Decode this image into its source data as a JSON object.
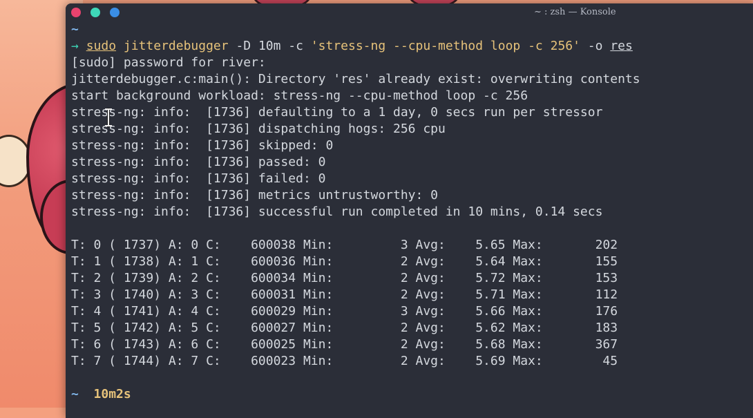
{
  "window": {
    "title": "~ : zsh — Konsole"
  },
  "terminal": {
    "cwd_line": "~",
    "command": {
      "arrow": "→",
      "sudo": "sudo",
      "binary": "jitterdebugger",
      "args1": " -D 10m -c ",
      "quoted": "'stress-ng --cpu-method loop -c 256'",
      "args2": " -o ",
      "outdir": "res"
    },
    "output": [
      "[sudo] password for river:",
      "jitterdebugger.c:main(): Directory 'res' already exist: overwriting contents",
      "start background workload: stress-ng --cpu-method loop -c 256",
      "stress-ng: info:  [1736] defaulting to a 1 day, 0 secs run per stressor",
      "stress-ng: info:  [1736] dispatching hogs: 256 cpu",
      "stress-ng: info:  [1736] skipped: 0",
      "stress-ng: info:  [1736] passed: 0",
      "stress-ng: info:  [1736] failed: 0",
      "stress-ng: info:  [1736] metrics untrustworthy: 0",
      "stress-ng: info:  [1736] successful run completed in 10 mins, 0.14 secs"
    ],
    "results": [
      "T: 0 ( 1737) A: 0 C:    600038 Min:         3 Avg:    5.65 Max:       202",
      "T: 1 ( 1738) A: 1 C:    600036 Min:         2 Avg:    5.64 Max:       155",
      "T: 2 ( 1739) A: 2 C:    600034 Min:         2 Avg:    5.72 Max:       153",
      "T: 3 ( 1740) A: 3 C:    600031 Min:         2 Avg:    5.71 Max:       112",
      "T: 4 ( 1741) A: 4 C:    600029 Min:         3 Avg:    5.66 Max:       176",
      "T: 5 ( 1742) A: 5 C:    600027 Min:         2 Avg:    5.62 Max:       183",
      "T: 6 ( 1743) A: 6 C:    600025 Min:         2 Avg:    5.68 Max:       367",
      "T: 7 ( 1744) A: 7 C:    600023 Min:         2 Avg:    5.69 Max:        45"
    ],
    "final_prompt": {
      "tilde": "~",
      "elapsed": "10m2s"
    }
  },
  "colors": {
    "terminal_bg": "#2b2e38",
    "close_button": "#e8436e",
    "minimize_button": "#3ed8b8",
    "maximize_button": "#3a8ee6",
    "command_highlight": "#e6c27a"
  }
}
